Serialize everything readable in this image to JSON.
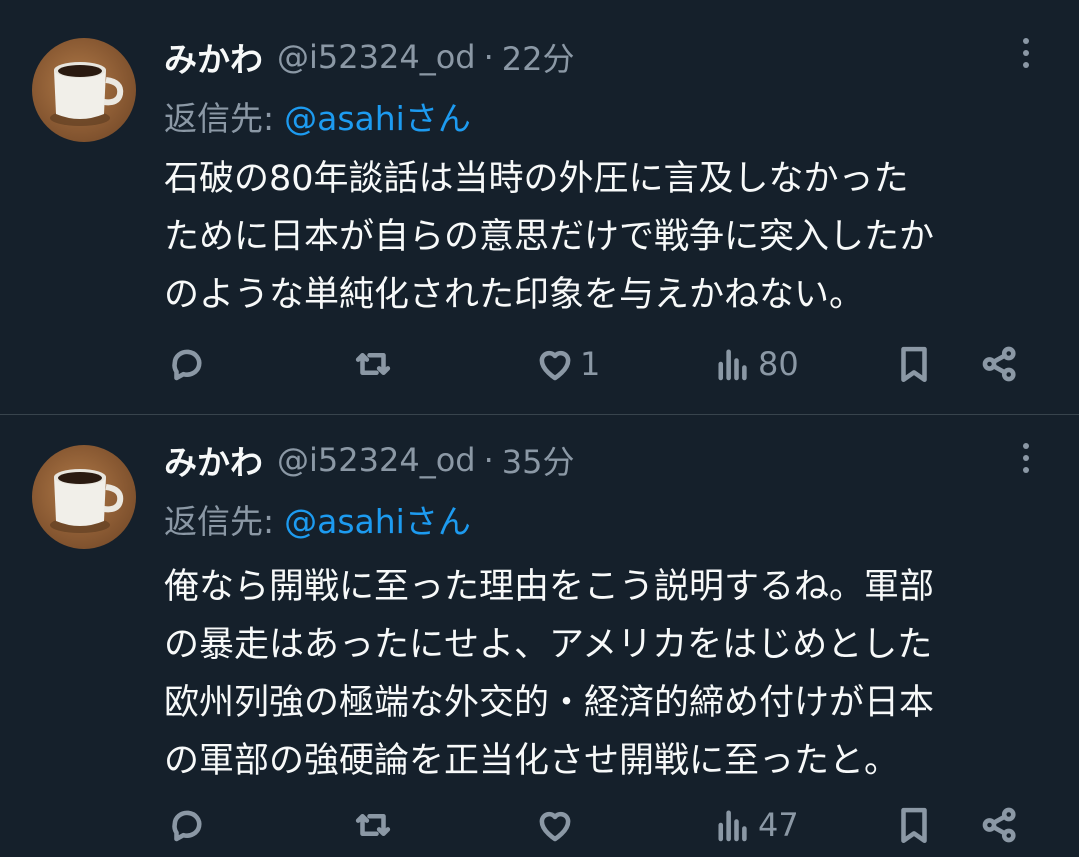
{
  "tweets": [
    {
      "name": "みかわ",
      "handle": "@i52324_od",
      "separator": "·",
      "time": "22分",
      "reply_prefix": "返信先:",
      "reply_target": "@asahiさん",
      "lines": [
        "石破の80年談話は当時の外圧に言及しなかった",
        "ために日本が自らの意思だけで戦争に突入したか",
        "のような単純化された印象を与えかねない。"
      ],
      "actions": {
        "replies": "",
        "retweets": "",
        "likes": "1",
        "views": "80"
      }
    },
    {
      "name": "みかわ",
      "handle": "@i52324_od",
      "separator": "·",
      "time": "35分",
      "reply_prefix": "返信先:",
      "reply_target": "@asahiさん",
      "lines": [
        "俺なら開戦に至った理由をこう説明するね。軍部",
        "の暴走はあったにせよ、アメリカをはじめとした",
        "欧州列強の極端な外交的・経済的締め付けが日本",
        "の軍部の強硬論を正当化させ開戦に至ったと。"
      ],
      "actions": {
        "replies": "",
        "retweets": "",
        "likes": "",
        "views": "47"
      }
    }
  ],
  "colors": {
    "background": "#15202b",
    "text": "#f7f9f9",
    "secondary": "#8b98a5",
    "link": "#1d9bf0",
    "divider": "#38444d"
  },
  "icons": [
    "coffee-mug-avatar",
    "more-icon",
    "reply-icon",
    "retweet-icon",
    "like-icon",
    "views-icon",
    "bookmark-icon",
    "share-icon"
  ]
}
